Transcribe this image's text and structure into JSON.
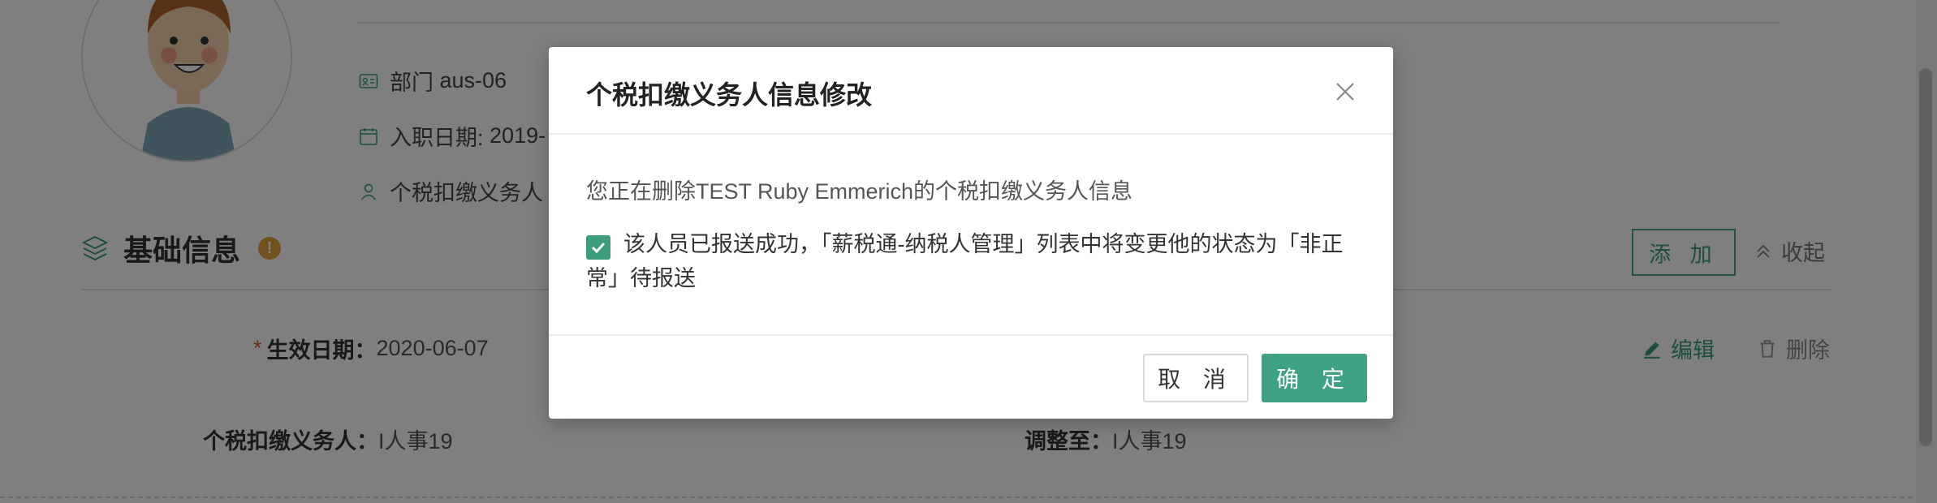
{
  "background": {
    "info_rows": [
      {
        "icon": "id-card-icon",
        "label": "部门",
        "value": "aus-06"
      },
      {
        "icon": "calendar-icon",
        "label": "入职日期:",
        "value": "2019-"
      },
      {
        "icon": "person-icon",
        "label": "个税扣缴义务人",
        "value": ""
      }
    ],
    "section_title": "基础信息",
    "warn_badge": "!",
    "add_label": "添 加",
    "collapse_label": "收起",
    "effective_date_label": "生效日期：",
    "effective_date_value": "2020-06-07",
    "required_mark": "*",
    "withholder_label": "个税扣缴义务人：",
    "withholder_value": "I人事19",
    "adjust_label": "调整至：",
    "adjust_value": "I人事19",
    "edit_label": "编辑",
    "delete_label": "删除"
  },
  "modal": {
    "title": "个税扣缴义务人信息修改",
    "message": "您正在删除TEST Ruby Emmerich的个税扣缴义务人信息",
    "checkbox_checked": true,
    "checkbox_text": "该人员已报送成功，「薪税通-纳税人管理」列表中将变更他的状态为「非正常」待报送",
    "cancel_label": "取 消",
    "confirm_label": "确 定"
  },
  "colors": {
    "primary": "#3fa184",
    "overlay": "rgba(0,0,0,0.5)",
    "warning": "#e6a23c",
    "required": "#e74c3c"
  }
}
